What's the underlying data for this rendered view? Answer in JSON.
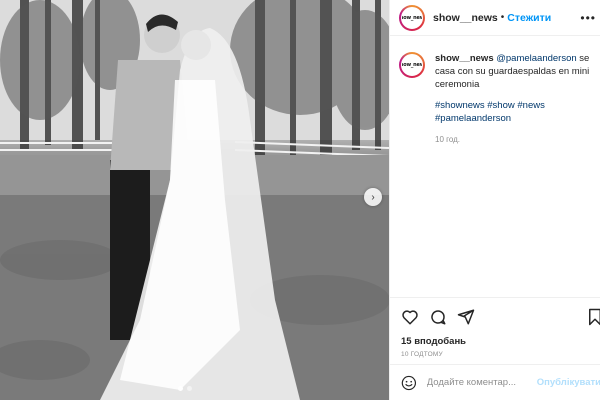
{
  "post": {
    "photo_alt": "",
    "carousel_next_symbol": "›",
    "carousel_dots": 2
  },
  "header": {
    "avatar_logo": "show_news",
    "username": "show__news",
    "separator": "•",
    "follow_label": "Стежити",
    "more_icon": "•••"
  },
  "caption": {
    "username": "show__news",
    "mention": "@pamelaanderson",
    "text": " se casa con su guardaespaldas en mini ceremonia",
    "hashtags": "#shownews #show #news #pamelaanderson",
    "age": "10 год."
  },
  "actions": {
    "like_icon": "heart-icon",
    "comment_icon": "comment-icon",
    "share_icon": "share-icon",
    "save_icon": "bookmark-icon",
    "likes": "15 вподобань",
    "timestamp": "10 ГОДТОМУ"
  },
  "comment": {
    "placeholder": "Додайте коментар...",
    "post_label": "Опублікувати"
  },
  "colors": {
    "accent": "#0095f6",
    "post_disabled": "#b2dffc",
    "link": "#00376b",
    "muted": "#8e8e8e"
  }
}
